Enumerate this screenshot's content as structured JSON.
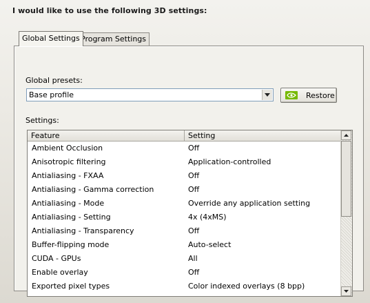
{
  "heading": "I would like to use the following 3D settings:",
  "tabs": [
    {
      "label": "Global Settings",
      "active": true
    },
    {
      "label": "Program Settings",
      "active": false
    }
  ],
  "global_presets": {
    "label": "Global presets:",
    "value": "Base profile",
    "restore_label": "Restore"
  },
  "settings": {
    "label": "Settings:",
    "columns": [
      "Feature",
      "Setting"
    ],
    "rows": [
      {
        "feature": "Ambient Occlusion",
        "setting": "Off"
      },
      {
        "feature": "Anisotropic filtering",
        "setting": "Application-controlled"
      },
      {
        "feature": "Antialiasing - FXAA",
        "setting": "Off"
      },
      {
        "feature": "Antialiasing - Gamma correction",
        "setting": "Off"
      },
      {
        "feature": "Antialiasing - Mode",
        "setting": "Override any application setting"
      },
      {
        "feature": "Antialiasing - Setting",
        "setting": "4x (4xMS)"
      },
      {
        "feature": "Antialiasing - Transparency",
        "setting": "Off"
      },
      {
        "feature": "Buffer-flipping mode",
        "setting": "Auto-select"
      },
      {
        "feature": "CUDA - GPUs",
        "setting": "All"
      },
      {
        "feature": "Enable overlay",
        "setting": "Off"
      },
      {
        "feature": "Exported pixel types",
        "setting": "Color indexed overlays (8 bpp)"
      }
    ]
  },
  "icons": {
    "preset_dropdown": "chevron-down-icon",
    "restore": "nvidia-logo-icon",
    "scroll_up": "scroll-up-arrow-icon",
    "scroll_down": "scroll-down-arrow-icon"
  },
  "colors": {
    "nvidia_green": "#76b900"
  }
}
